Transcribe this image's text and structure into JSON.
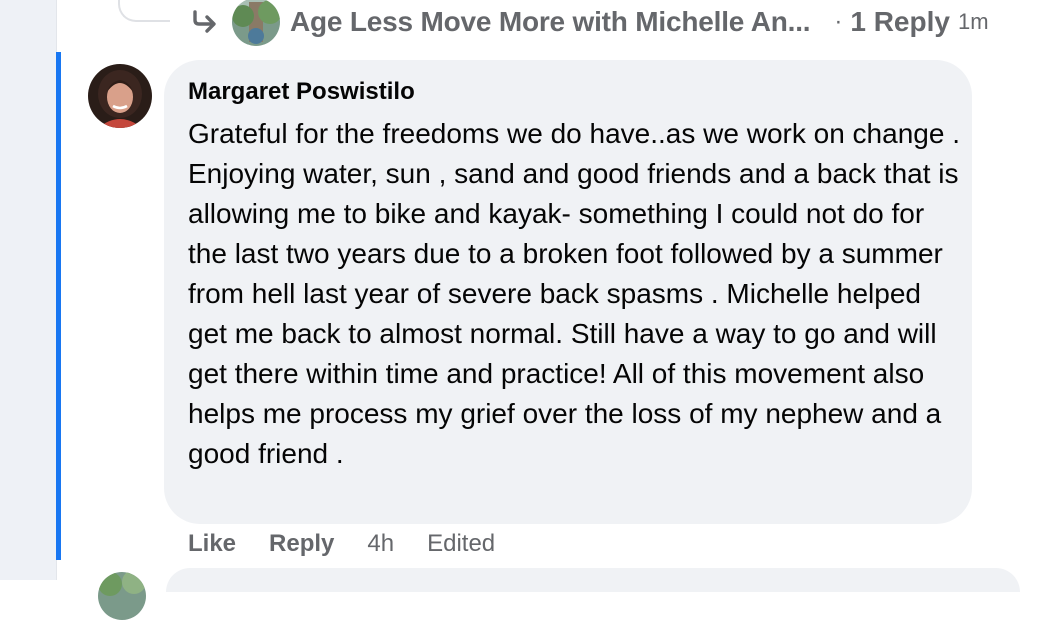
{
  "thread_reply": {
    "page_name": "Age Less Move More with Michelle An...",
    "separator": "·",
    "reply_count": "1 Reply",
    "time": "1m",
    "arrow_icon": "reply-arrow-icon"
  },
  "comment": {
    "author": "Margaret Poswistilo",
    "text": "Grateful for the freedoms we do have..as we work on change . Enjoying water, sun , sand and good friends and a back that is allowing me to bike and kayak- something I could not do for the last two years due to a broken foot followed by a summer from hell last year of severe back spasms . Michelle helped get me back to almost normal. Still have a way to go and will get there within time and practice! All of this movement also helps me process my grief over the loss of my nephew and a good friend .",
    "actions": {
      "like": "Like",
      "reply": "Reply",
      "time": "4h",
      "edited": "Edited"
    }
  },
  "colors": {
    "highlight": "#1877f2",
    "bubble": "#f0f2f5",
    "secondary_text": "#65676b"
  }
}
